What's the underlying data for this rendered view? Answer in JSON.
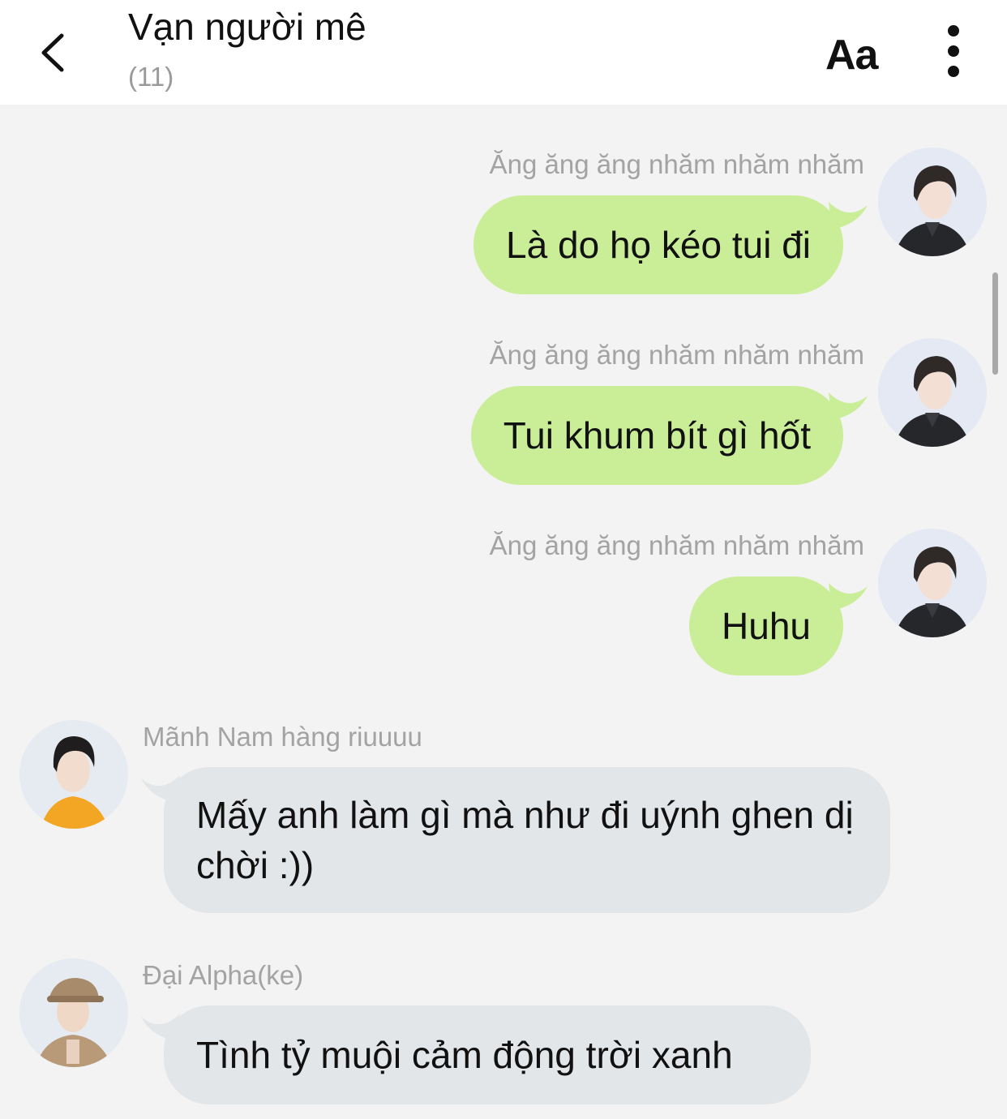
{
  "header": {
    "title": "Vạn người mê",
    "member_count": "(11)",
    "font_label": "Aa"
  },
  "messages": [
    {
      "sender": "Ăng ăng ăng nhăm nhăm nhăm",
      "text": "Là do họ kéo tui đi",
      "direction": "outgoing"
    },
    {
      "sender": "Ăng ăng ăng nhăm nhăm nhăm",
      "text": "Tui khum bít gì hốt",
      "direction": "outgoing"
    },
    {
      "sender": "Ăng ăng ăng nhăm nhăm nhăm",
      "text": "Huhu",
      "direction": "outgoing"
    },
    {
      "sender": "Mãnh Nam hàng riuuuu",
      "text": "Mấy anh làm gì mà như đi uýnh ghen dị chời :))",
      "direction": "incoming"
    },
    {
      "sender": "Đại Alpha(ke)",
      "text": "Tình tỷ muội cảm động trời xanh",
      "direction": "incoming"
    }
  ],
  "colors": {
    "outgoing_bubble": "#c9ee97",
    "incoming_bubble": "#e3e6e9",
    "background": "#f3f3f3"
  }
}
